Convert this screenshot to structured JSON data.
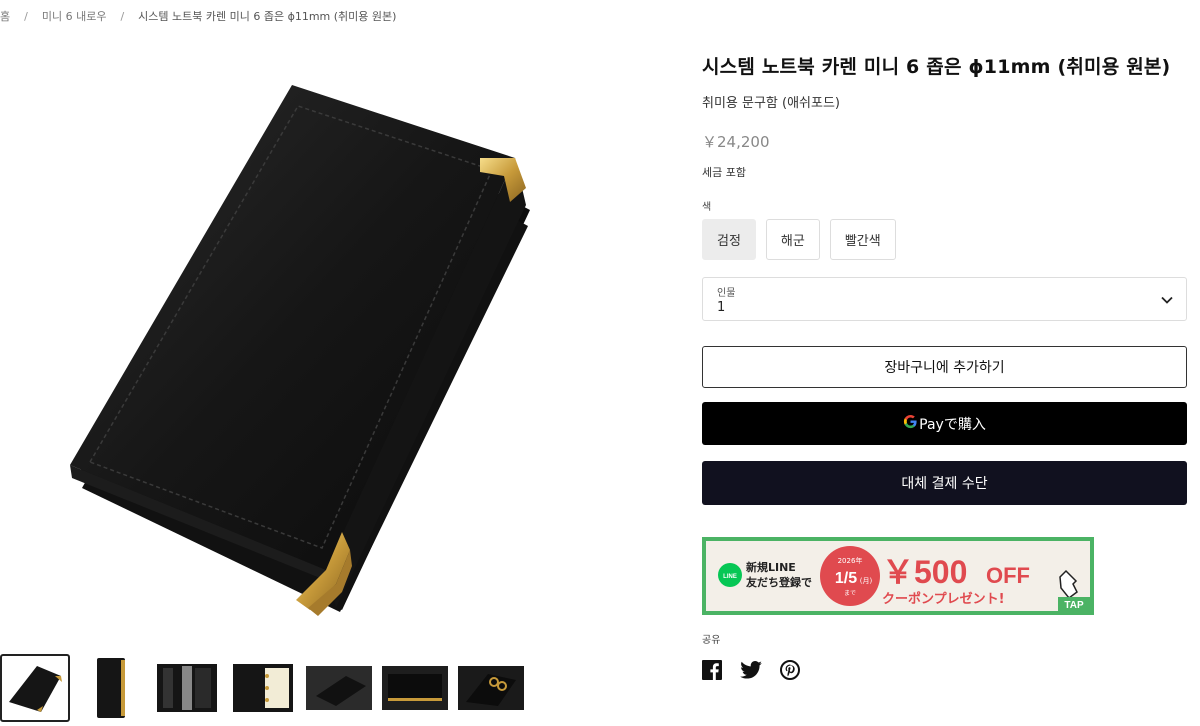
{
  "breadcrumb": {
    "home": "홈",
    "sep": "/",
    "collection": "미니 6 내로우",
    "current": "시스템 노트북 카렌 미니 6 좁은 ϕ11mm (취미용 원본)"
  },
  "product": {
    "title": "시스템 노트북 카렌 미니 6 좁은 ϕ11mm (취미용 원본)",
    "vendor": "취미용 문구함 (애쉬포드)",
    "price": "￥24,200",
    "tax_note": "세금 포함"
  },
  "color_option": {
    "label": "색",
    "values": [
      "검정",
      "해군",
      "빨간색"
    ],
    "selected": "검정"
  },
  "quantity": {
    "label": "인물",
    "value": "1"
  },
  "buttons": {
    "add_to_cart": "장바구니에 추가하기",
    "gpay_suffix": "Payで購入",
    "alt_payment": "대체 결제 수단"
  },
  "banner": {
    "line_logo": "LINE",
    "line1": "新規LINE",
    "line2": "友だち登録で",
    "date_year": "2026年",
    "date": "1/5",
    "date_day": "(月)",
    "date_suffix": "まで",
    "amount": "￥500",
    "off": "OFF",
    "coupon": "クーポンプレゼント!",
    "tap": "TAP"
  },
  "share": {
    "label": "공유"
  },
  "colors": {
    "gpay_bg": "#000000",
    "alt_bg": "#11111f",
    "banner_green": "#4bb364",
    "banner_red": "#e04a4f"
  }
}
